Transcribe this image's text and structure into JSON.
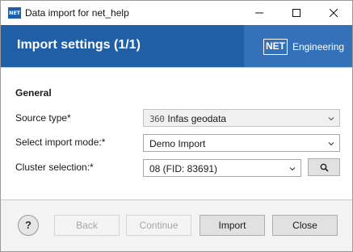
{
  "window": {
    "app_icon_text": "NET",
    "title": "Data import for net_help",
    "controls": {
      "minimize": "minimize-icon",
      "maximize": "maximize-icon",
      "close": "close-icon"
    }
  },
  "header": {
    "title": "Import settings (1/1)",
    "brand_logo": "NET",
    "brand_text": "Engineering",
    "background": "#1f5fa6"
  },
  "form": {
    "section_title": "General",
    "source_type": {
      "label": "Source type*",
      "icon_text": "360",
      "value": "Infas geodata",
      "enabled": false
    },
    "import_mode": {
      "label": "Select import mode:*",
      "value": "Demo Import"
    },
    "cluster": {
      "label": "Cluster selection:*",
      "value": "08 (FID: 83691)",
      "search_icon": "search-icon"
    }
  },
  "footer": {
    "help_label": "?",
    "back_label": "Back",
    "continue_label": "Continue",
    "import_label": "Import",
    "close_label": "Close"
  }
}
